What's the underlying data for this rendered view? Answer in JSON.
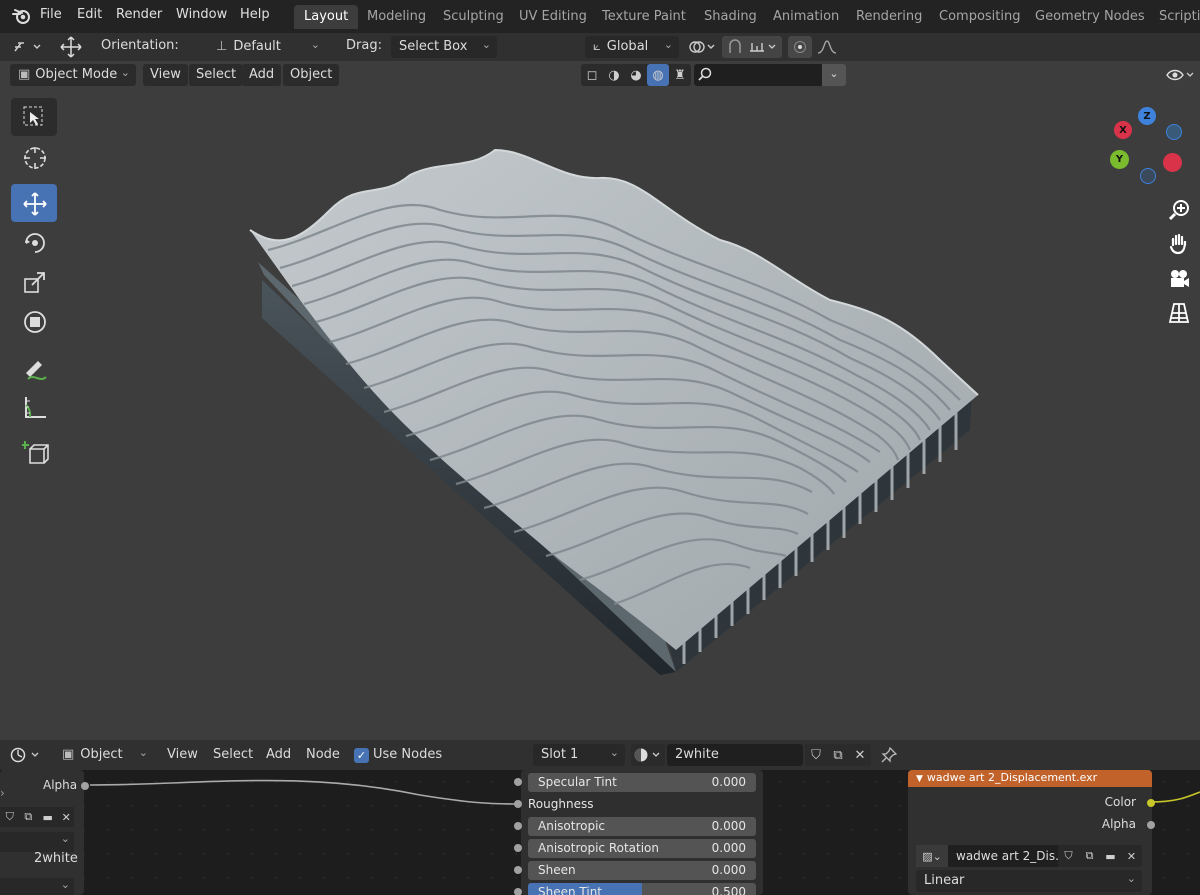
{
  "topbar": {
    "menu": [
      "File",
      "Edit",
      "Render",
      "Window",
      "Help"
    ],
    "workspaces": [
      "Layout",
      "Modeling",
      "Sculpting",
      "UV Editing",
      "Texture Paint",
      "Shading",
      "Animation",
      "Rendering",
      "Compositing",
      "Geometry Nodes",
      "Scriptin"
    ],
    "active_workspace": "Layout"
  },
  "viewport_header": {
    "orientation_label": "Orientation:",
    "orientation_value": "Default",
    "drag_label": "Drag:",
    "drag_value": "Select Box",
    "transform_orientation": "Global",
    "mode": "Object Mode",
    "menus": [
      "View",
      "Select",
      "Add",
      "Object"
    ],
    "search_value": ""
  },
  "toolbar": {
    "tools": [
      "select-box",
      "cursor",
      "move",
      "rotate",
      "scale",
      "transform",
      "annotate",
      "measure",
      "add-cube"
    ],
    "active": "move"
  },
  "gizmo": {
    "axes": [
      "X",
      "Y",
      "Z"
    ],
    "colors": {
      "x": "#d9334a",
      "y": "#7bbc2e",
      "z": "#3f82db"
    }
  },
  "node_editor": {
    "editor_type": "Object",
    "menus": [
      "View",
      "Select",
      "Add",
      "Node"
    ],
    "use_nodes_label": "Use Nodes",
    "use_nodes_checked": true,
    "slot": "Slot 1",
    "material": "2white",
    "left_node": {
      "output": "Alpha",
      "material": "2white"
    },
    "bsdf_rows": [
      {
        "label": "Specular Tint",
        "value": "0.000"
      },
      {
        "label": "Roughness",
        "value": ""
      },
      {
        "label": "Anisotropic",
        "value": "0.000"
      },
      {
        "label": "Anisotropic Rotation",
        "value": "0.000"
      },
      {
        "label": "Sheen",
        "value": "0.000"
      },
      {
        "label": "Sheen Tint",
        "value": "0.500"
      }
    ],
    "sheen_tint_fill": 0.5,
    "image_node": {
      "title": "wadwe art 2_Displacement.exr",
      "outputs": [
        "Color",
        "Alpha"
      ],
      "image_name": "wadwe art 2_Dis...",
      "interpolation": "Linear",
      "header_color": "#c0622a"
    }
  }
}
